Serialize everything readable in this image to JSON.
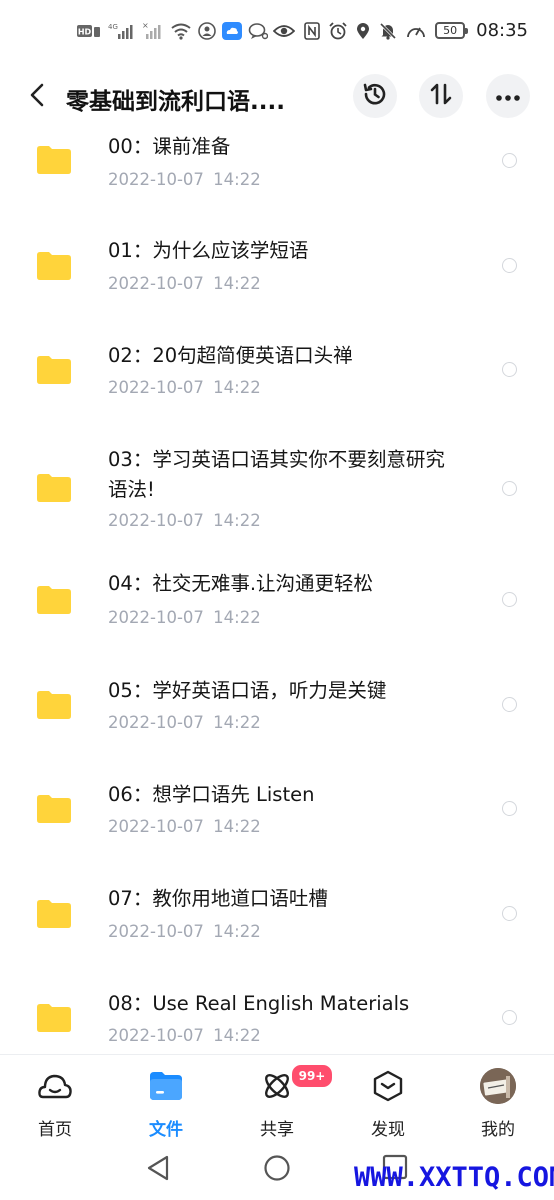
{
  "status_bar": {
    "left_icons": [
      "hd-icon",
      "signal-icon",
      "signal-icon",
      "wifi-icon",
      "shield-icon",
      "cloud-icon",
      "chat-icon"
    ],
    "right_icons": [
      "eye-icon",
      "nfc-icon",
      "alarm-icon",
      "location-icon",
      "mute-icon",
      "speed-icon"
    ],
    "battery": "50",
    "time": "08:35"
  },
  "header": {
    "title": "零基础到流利口语....",
    "buttons": [
      "back-icon",
      "history-icon",
      "sort-icon",
      "more-icon"
    ]
  },
  "files": [
    {
      "name": "00：课前准备",
      "date": "2022-10-07  14:22"
    },
    {
      "name": "01：为什么应该学短语",
      "date": "2022-10-07  14:22"
    },
    {
      "name": "02：20句超简便英语口头禅",
      "date": "2022-10-07  14:22"
    },
    {
      "name": "03：学习英语口语其实你不要刻意研究语法!",
      "date": "2022-10-07  14:22"
    },
    {
      "name": "04：社交无难事.让沟通更轻松",
      "date": "2022-10-07  14:22"
    },
    {
      "name": "05：学好英语口语，听力是关键",
      "date": "2022-10-07  14:22"
    },
    {
      "name": "06：想学口语先 Listen",
      "date": "2022-10-07  14:22"
    },
    {
      "name": "07：教你用地道口语吐槽",
      "date": "2022-10-07  14:22"
    },
    {
      "name": "08：Use Real English Materials",
      "date": "2022-10-07  14:22"
    }
  ],
  "colors": {
    "accent": "#1b8cff",
    "folder": "#ffd43b",
    "date_text": "#a3a8b3",
    "badge": "#ff4d6d"
  },
  "bottom_nav": {
    "home": "首页",
    "files": "文件",
    "share": "共享",
    "discover": "发现",
    "mine": "我的",
    "share_badge": "99+",
    "active": "files"
  },
  "watermark": "WWW.XXTTQ.COM"
}
